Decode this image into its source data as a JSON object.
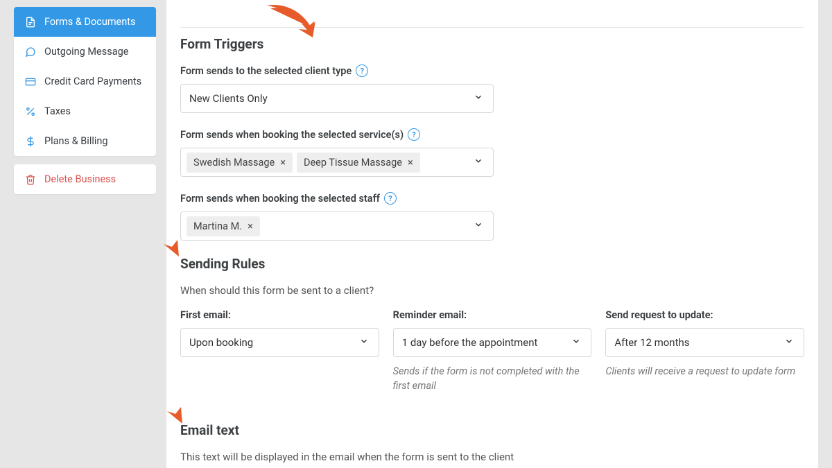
{
  "sidebar": {
    "items": [
      {
        "label": "Forms & Documents"
      },
      {
        "label": "Outgoing Message"
      },
      {
        "label": "Credit Card Payments"
      },
      {
        "label": "Taxes"
      },
      {
        "label": "Plans & Billing"
      }
    ],
    "delete_label": "Delete Business"
  },
  "triggers": {
    "title": "Form Triggers",
    "client_type_label": "Form sends to the selected client type",
    "client_type_value": "New Clients Only",
    "services_label": "Form sends when booking the selected service(s)",
    "service_chips": [
      "Swedish Massage",
      "Deep Tissue Massage"
    ],
    "staff_label": "Form sends when booking the selected staff",
    "staff_chips": [
      "Martina M."
    ]
  },
  "sending": {
    "title": "Sending Rules",
    "subtitle": "When should this form be sent to a client?",
    "first_label": "First email:",
    "first_value": "Upon booking",
    "reminder_label": "Reminder email:",
    "reminder_value": "1 day before the appointment",
    "reminder_hint": "Sends if the form is not completed with the first email",
    "update_label": "Send request to update:",
    "update_value": "After 12 months",
    "update_hint": "Clients will receive a request to update form"
  },
  "email": {
    "title": "Email text",
    "subtitle": "This text will be displayed in the email when the form is sent to the client"
  },
  "glyphs": {
    "help": "?",
    "close": "×"
  }
}
